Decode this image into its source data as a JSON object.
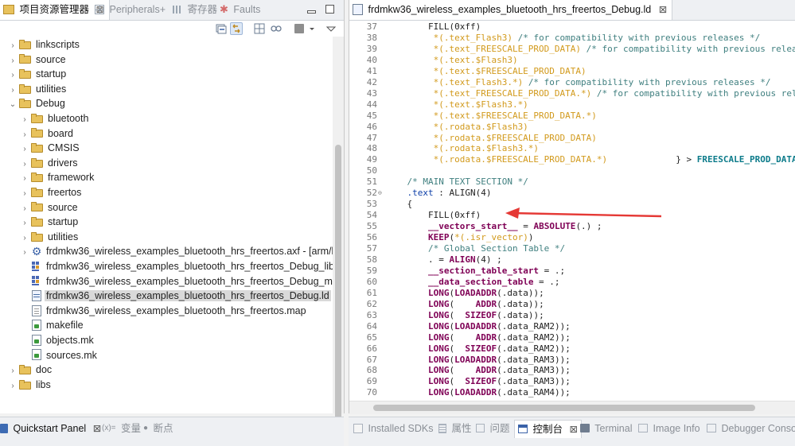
{
  "left_panel": {
    "tabs": [
      {
        "label": "项目资源管理器",
        "active": true,
        "icon": "folder-icon",
        "close": "⊠"
      },
      {
        "label": "Peripherals+",
        "active": false,
        "icon": "peripherals-icon"
      },
      {
        "label": "寄存器",
        "active": false,
        "icon": "registers-icon"
      },
      {
        "label": "Faults",
        "active": false,
        "icon": "faults-icon"
      }
    ],
    "tree": [
      {
        "label": "linkscripts",
        "indent": 0,
        "chevron": "›",
        "icon": "source-folder"
      },
      {
        "label": "source",
        "indent": 0,
        "chevron": "›",
        "icon": "source-folder"
      },
      {
        "label": "startup",
        "indent": 0,
        "chevron": "›",
        "icon": "source-folder"
      },
      {
        "label": "utilities",
        "indent": 0,
        "chevron": "›",
        "icon": "source-folder"
      },
      {
        "label": "Debug",
        "indent": 0,
        "chevron": "⌄",
        "icon": "folder"
      },
      {
        "label": "bluetooth",
        "indent": 1,
        "chevron": "›",
        "icon": "folder"
      },
      {
        "label": "board",
        "indent": 1,
        "chevron": "›",
        "icon": "folder"
      },
      {
        "label": "CMSIS",
        "indent": 1,
        "chevron": "›",
        "icon": "folder"
      },
      {
        "label": "drivers",
        "indent": 1,
        "chevron": "›",
        "icon": "folder"
      },
      {
        "label": "framework",
        "indent": 1,
        "chevron": "›",
        "icon": "folder"
      },
      {
        "label": "freertos",
        "indent": 1,
        "chevron": "›",
        "icon": "folder"
      },
      {
        "label": "source",
        "indent": 1,
        "chevron": "›",
        "icon": "folder"
      },
      {
        "label": "startup",
        "indent": 1,
        "chevron": "›",
        "icon": "folder"
      },
      {
        "label": "utilities",
        "indent": 1,
        "chevron": "›",
        "icon": "folder"
      },
      {
        "label": "frdmkw36_wireless_examples_bluetooth_hrs_freertos.axf - [arm/le]",
        "indent": 1,
        "chevron": "›",
        "icon": "gear"
      },
      {
        "label": "frdmkw36_wireless_examples_bluetooth_hrs_freertos_Debug_library",
        "indent": 1,
        "chevron": "",
        "icon": "grid"
      },
      {
        "label": "frdmkw36_wireless_examples_bluetooth_hrs_freertos_Debug_memory",
        "indent": 1,
        "chevron": "",
        "icon": "grid"
      },
      {
        "label": "frdmkw36_wireless_examples_bluetooth_hrs_freertos_Debug.ld",
        "indent": 1,
        "chevron": "",
        "icon": "ld-file",
        "selected": true
      },
      {
        "label": "frdmkw36_wireless_examples_bluetooth_hrs_freertos.map",
        "indent": 1,
        "chevron": "",
        "icon": "map-file"
      },
      {
        "label": "makefile",
        "indent": 1,
        "chevron": "",
        "icon": "mk-file"
      },
      {
        "label": "objects.mk",
        "indent": 1,
        "chevron": "",
        "icon": "mk-file"
      },
      {
        "label": "sources.mk",
        "indent": 1,
        "chevron": "",
        "icon": "mk-file"
      },
      {
        "label": "doc",
        "indent": 0,
        "chevron": "›",
        "icon": "folder"
      },
      {
        "label": "libs",
        "indent": 0,
        "chevron": "›",
        "icon": "folder"
      }
    ]
  },
  "editor": {
    "tab_label": "frdmkw36_wireless_examples_bluetooth_hrs_freertos_Debug.ld",
    "close": "⊠",
    "lines": [
      {
        "n": "37",
        "fold": "",
        "seg": [
          [
            "        ",
            "kn"
          ],
          [
            "FILL",
            "kn"
          ],
          [
            "(0xff)",
            "kn"
          ]
        ]
      },
      {
        "n": "38",
        "fold": "",
        "seg": [
          [
            "         *(.text_Flash3) ",
            "st"
          ],
          [
            "/* for compatibility with previous releases */",
            "cm"
          ]
        ]
      },
      {
        "n": "39",
        "fold": "",
        "seg": [
          [
            "         *(.text_FREESCALE_PROD_DATA) ",
            "st"
          ],
          [
            "/* for compatibility with previous releases */",
            "cm"
          ]
        ]
      },
      {
        "n": "40",
        "fold": "",
        "seg": [
          [
            "         *(.text.$Flash3)",
            "st"
          ]
        ]
      },
      {
        "n": "41",
        "fold": "",
        "seg": [
          [
            "         *(.text.$FREESCALE_PROD_DATA)",
            "st"
          ]
        ]
      },
      {
        "n": "42",
        "fold": "",
        "seg": [
          [
            "         *(.text_Flash3.*) ",
            "st"
          ],
          [
            "/* for compatibility with previous releases */",
            "cm"
          ]
        ]
      },
      {
        "n": "43",
        "fold": "",
        "seg": [
          [
            "         *(.text_FREESCALE_PROD_DATA.*) ",
            "st"
          ],
          [
            "/* for compatibility with previous releases */",
            "cm"
          ]
        ]
      },
      {
        "n": "44",
        "fold": "",
        "seg": [
          [
            "         *(.text.$Flash3.*)",
            "st"
          ]
        ]
      },
      {
        "n": "45",
        "fold": "",
        "seg": [
          [
            "         *(.text.$FREESCALE_PROD_DATA.*)",
            "st"
          ]
        ]
      },
      {
        "n": "46",
        "fold": "",
        "seg": [
          [
            "         *(.rodata.$Flash3)",
            "st"
          ]
        ]
      },
      {
        "n": "47",
        "fold": "",
        "seg": [
          [
            "         *(.rodata.$FREESCALE_PROD_DATA)",
            "st"
          ]
        ]
      },
      {
        "n": "48",
        "fold": "",
        "seg": [
          [
            "         *(.rodata.$Flash3.*)",
            "st"
          ]
        ]
      },
      {
        "n": "49",
        "fold": "",
        "seg": [
          [
            "         *(.rodata.$FREESCALE_PROD_DATA.*)",
            "st"
          ],
          [
            "             } > ",
            "kn"
          ],
          [
            "FREESCALE_PROD_DATA",
            "tb2"
          ]
        ]
      },
      {
        "n": "50",
        "fold": "",
        "seg": [
          [
            "",
            "kn"
          ]
        ]
      },
      {
        "n": "51",
        "fold": "",
        "seg": [
          [
            "    ",
            "kn"
          ],
          [
            "/* MAIN TEXT SECTION */",
            "cm"
          ]
        ]
      },
      {
        "n": "52",
        "fold": "⊖",
        "seg": [
          [
            "    ",
            "kn"
          ],
          [
            ".text",
            "sec"
          ],
          [
            " : ",
            "kn"
          ],
          [
            "ALIGN",
            "kn"
          ],
          [
            "(4)",
            "kn"
          ]
        ]
      },
      {
        "n": "53",
        "fold": "",
        "seg": [
          [
            "    {",
            "kn"
          ]
        ]
      },
      {
        "n": "54",
        "fold": "",
        "seg": [
          [
            "        FILL(0xff)",
            "kn"
          ]
        ]
      },
      {
        "n": "55",
        "fold": "",
        "seg": [
          [
            "        ",
            "kn"
          ],
          [
            "__vectors_start__",
            "kw"
          ],
          [
            " = ",
            "kn"
          ],
          [
            "ABSOLUTE",
            "kw"
          ],
          [
            "(.) ;",
            "kn"
          ]
        ]
      },
      {
        "n": "56",
        "fold": "",
        "seg": [
          [
            "        ",
            "kn"
          ],
          [
            "KEEP",
            "kw"
          ],
          [
            "(",
            "kn"
          ],
          [
            "*(.isr_vector)",
            "st"
          ],
          [
            ")",
            "kn"
          ]
        ]
      },
      {
        "n": "57",
        "fold": "",
        "seg": [
          [
            "        ",
            "kn"
          ],
          [
            "/* Global Section Table */",
            "cm"
          ]
        ]
      },
      {
        "n": "58",
        "fold": "",
        "seg": [
          [
            "        . = ",
            "kn"
          ],
          [
            "ALIGN",
            "kw"
          ],
          [
            "(4) ;",
            "kn"
          ]
        ]
      },
      {
        "n": "59",
        "fold": "",
        "seg": [
          [
            "        ",
            "kn"
          ],
          [
            "__section_table_start",
            "kw"
          ],
          [
            " = .;",
            "kn"
          ]
        ]
      },
      {
        "n": "60",
        "fold": "",
        "seg": [
          [
            "        ",
            "kn"
          ],
          [
            "__data_section_table",
            "kw"
          ],
          [
            " = .;",
            "kn"
          ]
        ]
      },
      {
        "n": "61",
        "fold": "",
        "seg": [
          [
            "        ",
            "kn"
          ],
          [
            "LONG",
            "kw"
          ],
          [
            "(",
            "kn"
          ],
          [
            "LOADADDR",
            "kw"
          ],
          [
            "(.data));",
            "kn"
          ]
        ]
      },
      {
        "n": "62",
        "fold": "",
        "seg": [
          [
            "        ",
            "kn"
          ],
          [
            "LONG",
            "kw"
          ],
          [
            "(    ",
            "kn"
          ],
          [
            "ADDR",
            "kw"
          ],
          [
            "(.data));",
            "kn"
          ]
        ]
      },
      {
        "n": "63",
        "fold": "",
        "seg": [
          [
            "        ",
            "kn"
          ],
          [
            "LONG",
            "kw"
          ],
          [
            "(  ",
            "kn"
          ],
          [
            "SIZEOF",
            "kw"
          ],
          [
            "(.data));",
            "kn"
          ]
        ]
      },
      {
        "n": "64",
        "fold": "",
        "seg": [
          [
            "        ",
            "kn"
          ],
          [
            "LONG",
            "kw"
          ],
          [
            "(",
            "kn"
          ],
          [
            "LOADADDR",
            "kw"
          ],
          [
            "(.data_RAM2));",
            "kn"
          ]
        ]
      },
      {
        "n": "65",
        "fold": "",
        "seg": [
          [
            "        ",
            "kn"
          ],
          [
            "LONG",
            "kw"
          ],
          [
            "(    ",
            "kn"
          ],
          [
            "ADDR",
            "kw"
          ],
          [
            "(.data_RAM2));",
            "kn"
          ]
        ]
      },
      {
        "n": "66",
        "fold": "",
        "seg": [
          [
            "        ",
            "kn"
          ],
          [
            "LONG",
            "kw"
          ],
          [
            "(  ",
            "kn"
          ],
          [
            "SIZEOF",
            "kw"
          ],
          [
            "(.data_RAM2));",
            "kn"
          ]
        ]
      },
      {
        "n": "67",
        "fold": "",
        "seg": [
          [
            "        ",
            "kn"
          ],
          [
            "LONG",
            "kw"
          ],
          [
            "(",
            "kn"
          ],
          [
            "LOADADDR",
            "kw"
          ],
          [
            "(.data_RAM3));",
            "kn"
          ]
        ]
      },
      {
        "n": "68",
        "fold": "",
        "seg": [
          [
            "        ",
            "kn"
          ],
          [
            "LONG",
            "kw"
          ],
          [
            "(    ",
            "kn"
          ],
          [
            "ADDR",
            "kw"
          ],
          [
            "(.data_RAM3));",
            "kn"
          ]
        ]
      },
      {
        "n": "69",
        "fold": "",
        "seg": [
          [
            "        ",
            "kn"
          ],
          [
            "LONG",
            "kw"
          ],
          [
            "(  ",
            "kn"
          ],
          [
            "SIZEOF",
            "kw"
          ],
          [
            "(.data_RAM3));",
            "kn"
          ]
        ]
      },
      {
        "n": "70",
        "fold": "",
        "seg": [
          [
            "        ",
            "kn"
          ],
          [
            "LONG",
            "kw"
          ],
          [
            "(",
            "kn"
          ],
          [
            "LOADADDR",
            "kw"
          ],
          [
            "(.data_RAM4));",
            "kn"
          ]
        ]
      }
    ]
  },
  "annotation": {
    "color": "#e53935",
    "points_to_line": "54"
  },
  "bottom_left": {
    "tabs": [
      {
        "label": "Quickstart Panel",
        "active": true,
        "icon": "quickstart-icon",
        "close": "⊠"
      },
      {
        "label": "变量",
        "active": false,
        "icon": "variables-icon",
        "prefix": "(x)="
      },
      {
        "label": "断点",
        "active": false,
        "icon": "breakpoints-icon",
        "prefix": "●"
      }
    ]
  },
  "bottom_right": {
    "tabs": [
      {
        "label": "Installed SDKs",
        "active": false,
        "icon": "sdk-icon"
      },
      {
        "label": "属性",
        "active": false,
        "icon": "properties-icon"
      },
      {
        "label": "问题",
        "active": false,
        "icon": "problems-icon"
      },
      {
        "label": "控制台",
        "active": true,
        "icon": "console-icon",
        "close": "⊠"
      },
      {
        "label": "Terminal",
        "active": false,
        "icon": "terminal-icon"
      },
      {
        "label": "Image Info",
        "active": false,
        "icon": "image-info-icon"
      },
      {
        "label": "Debugger Console",
        "active": false,
        "icon": "debugger-console-icon"
      }
    ]
  },
  "colors": {
    "selected_row": "#d9d9d9",
    "keyword": "#7f0055",
    "string": "#d29a1c",
    "comment": "#3f7f7f",
    "folder": "#e8c25c"
  }
}
